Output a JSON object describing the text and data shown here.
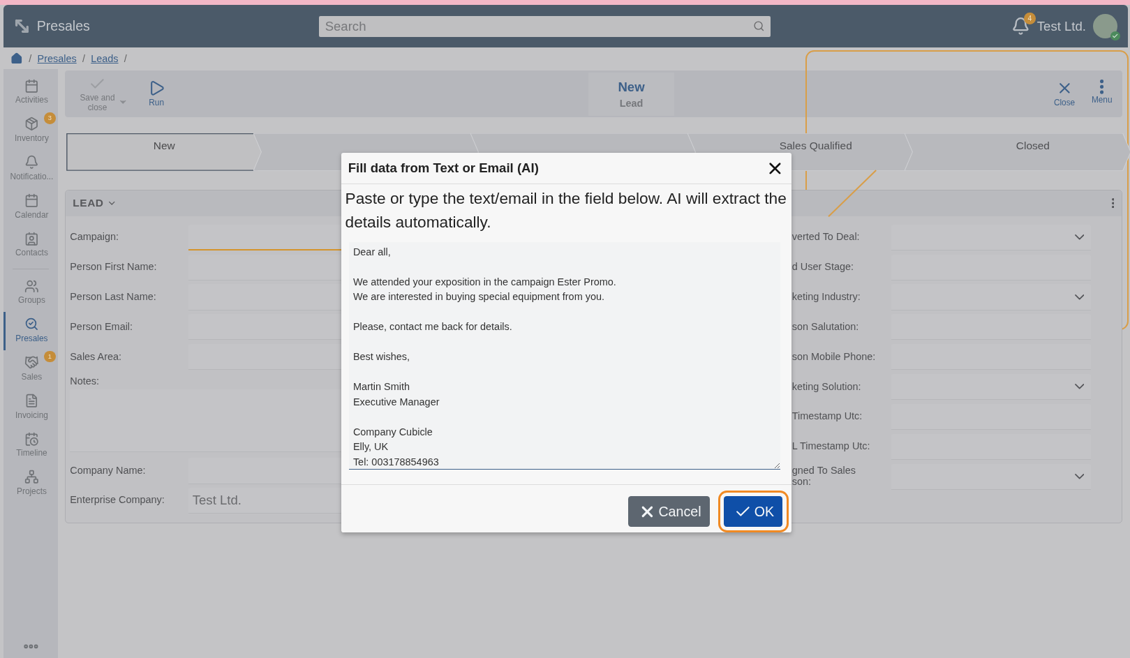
{
  "header": {
    "title": "Presales",
    "search": {
      "placeholder": "Search"
    },
    "notification_count": "4",
    "company": "Test Ltd."
  },
  "breadcrumb": [
    {
      "kind": "separator",
      "text": "/"
    },
    {
      "kind": "link",
      "text": "Presales"
    },
    {
      "kind": "separator",
      "text": "/"
    },
    {
      "kind": "link",
      "text": "Leads"
    },
    {
      "kind": "separator",
      "text": "/"
    }
  ],
  "sidebar": {
    "items": [
      {
        "label": "Activities",
        "selected": false
      },
      {
        "label": "Inventory",
        "badge": "3",
        "selected": false
      },
      {
        "label": "Notificatio...",
        "selected": false
      },
      {
        "label": "Calendar",
        "selected": false
      },
      {
        "label": "Contacts",
        "selected": false
      },
      {
        "label": "Groups",
        "selected": false
      },
      {
        "label": "Presales",
        "selected": true
      },
      {
        "label": "Sales",
        "badge": "1",
        "selected": false
      },
      {
        "label": "Invoicing",
        "selected": false
      },
      {
        "label": "Timeline",
        "selected": false
      },
      {
        "label": "Projects",
        "selected": false
      }
    ]
  },
  "toolbar": {
    "actions": [
      {
        "label": "Save and close",
        "kind": "save",
        "disabled": true
      },
      {
        "label": "Run",
        "kind": "run",
        "disabled": false
      }
    ],
    "title": "New",
    "subtitle": "Lead",
    "right_actions": [
      {
        "label": "Close",
        "kind": "close"
      },
      {
        "label": "Menu",
        "kind": "menu"
      }
    ]
  },
  "stages": [
    {
      "label": "New",
      "selected": true
    },
    {
      "selected": false
    },
    {
      "selected": false
    },
    {
      "label": "Sales Qualified",
      "selected": false
    },
    {
      "label": "Closed",
      "selected": false
    }
  ],
  "section": {
    "title": "LEAD",
    "left_fields": [
      {
        "label": "Campaign:",
        "kind": "text",
        "focused": true
      },
      {
        "label": "Person First Name:",
        "kind": "text",
        "focused": false
      },
      {
        "label": "Person Last Name:",
        "kind": "text",
        "focused": false
      },
      {
        "label": "Person Email:",
        "kind": "text",
        "focused": false
      },
      {
        "label": "Sales Area:",
        "kind": "text",
        "focused": false
      },
      {
        "label": "Notes:",
        "kind": "textarea",
        "focused": false
      },
      {
        "label": "Company Name:",
        "kind": "text",
        "focused": false
      },
      {
        "label": "Enterprise Company:",
        "kind": "text",
        "value": "Test Ltd.",
        "focused": false
      }
    ],
    "right_fields": [
      {
        "label": "verted To Deal:",
        "kind": "select"
      },
      {
        "label": "d User Stage:",
        "kind": "text"
      },
      {
        "label": "keting Industry:",
        "kind": "select"
      },
      {
        "label": "son Salutation:",
        "kind": "text"
      },
      {
        "label": "son Mobile Phone:",
        "kind": "text"
      },
      {
        "label": "keting Solution:",
        "kind": "select"
      },
      {
        "label": "Timestamp Utc:",
        "kind": "text"
      },
      {
        "label": "L Timestamp Utc:",
        "kind": "text"
      },
      {
        "label": "gned To Sales\nson:",
        "kind": "select"
      }
    ]
  },
  "dialog": {
    "title": "Fill data from Text or Email (AI)",
    "instructions": "Paste or type the text/email in the field below. AI will extract the details automatically.",
    "text": "Dear all,\n\nWe attended your exposition in the campaign Ester Promo.\nWe are interested in buying special equipment from you.\n\nPlease, contact me back for details.\n\nBest wishes,\n\nMartin Smith\nExecutive Manager\n\nCompany Cubicle\nElly, UK\nTel: 003178854963",
    "buttons": [
      {
        "label": "Cancel",
        "kind": "cancel",
        "highlighted": false
      },
      {
        "label": "OK",
        "kind": "ok",
        "highlighted": true
      }
    ]
  }
}
